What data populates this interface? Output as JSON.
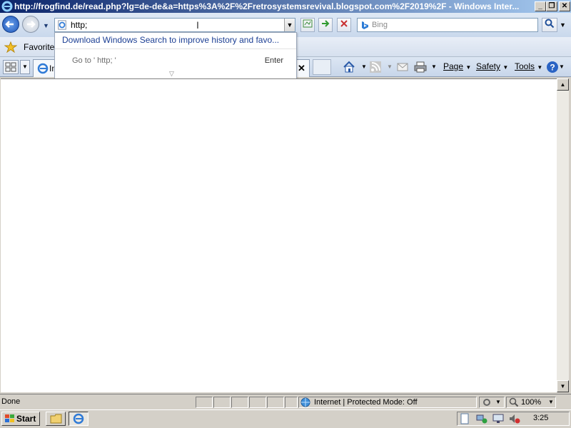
{
  "window": {
    "title": "http://frogfind.de/read.php?lg=de-de&a=https%3A%2F%2Fretrosystemsrevival.blogspot.com%2F2019%2F - Windows Inter..."
  },
  "address_bar": {
    "value": "http;"
  },
  "search": {
    "placeholder": "Bing"
  },
  "favorites_bar": {
    "label": "Favorites"
  },
  "tab": {
    "label": "In"
  },
  "autocomplete": {
    "suggestion": "Download Windows Search to improve history and favo...",
    "goto_text": "Go to ' http; '",
    "enter_label": "Enter"
  },
  "command_bar": {
    "page": "Page",
    "safety": "Safety",
    "tools": "Tools"
  },
  "status_bar": {
    "status": "Done",
    "zone": "Internet | Protected Mode: Off",
    "zoom": "100%"
  },
  "taskbar": {
    "start": "Start",
    "clock": "3:25"
  },
  "colors": {
    "titlebar_start": "#0a246a",
    "titlebar_end": "#a6caf0",
    "link": "#1c3f94"
  }
}
